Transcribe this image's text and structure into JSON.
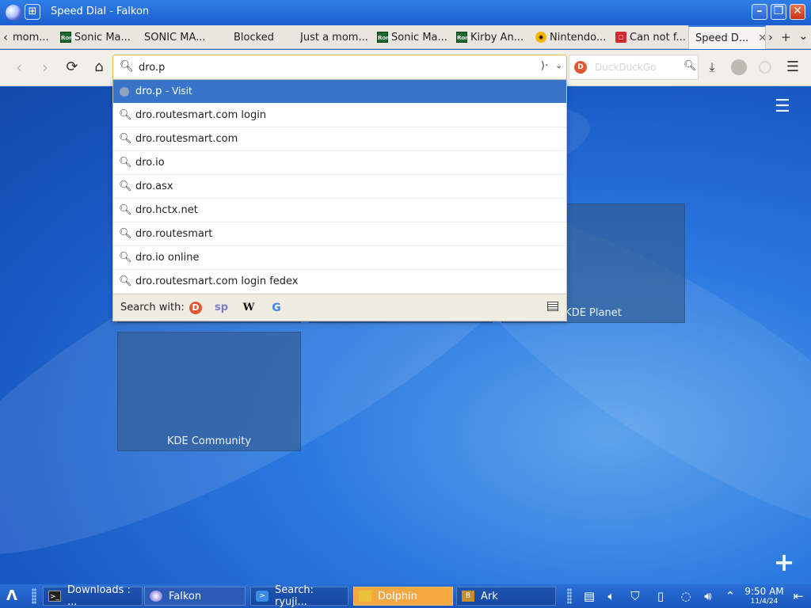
{
  "window": {
    "title": "Speed Dial - Falkon",
    "grid_icon": "grid-icon",
    "buttons": {
      "minimize": "–",
      "maximize": "❐",
      "close": "✕"
    }
  },
  "tabs": [
    {
      "label": "mom...",
      "favicon": ""
    },
    {
      "label": "Sonic Ma...",
      "favicon": "Roms"
    },
    {
      "label": "SONIC MA...",
      "favicon": ""
    },
    {
      "label": "Blocked",
      "favicon": ""
    },
    {
      "label": "Just a mom...",
      "favicon": ""
    },
    {
      "label": "Sonic Ma...",
      "favicon": "Roms"
    },
    {
      "label": "Kirby An...",
      "favicon": "Roms"
    },
    {
      "label": "Nintendo...",
      "favicon": "nintendo-icon"
    },
    {
      "label": "Can not f...",
      "favicon": "cannot-icon"
    },
    {
      "label": "Speed D...",
      "favicon": "",
      "active": true
    }
  ],
  "tab_controls": {
    "scroll_left": "‹",
    "scroll_right": "›",
    "new_tab": "+",
    "tab_list": "⌄"
  },
  "nav": {
    "back": "‹",
    "forward": "›",
    "reload": "⟳",
    "home": "⌂",
    "url_value": "dro.p",
    "search_placeholder": "DuckDuckGo"
  },
  "dropdown": {
    "selected": {
      "text": "dro.p",
      "suffix": "-  Visit"
    },
    "suggestions": [
      "dro.routesmart.com login",
      "dro.routesmart.com",
      "dro.io",
      "dro.asx",
      "dro.hctx.net",
      "dro.routesmart",
      "dro.io online",
      "dro.routesmart.com login fedex"
    ],
    "search_with_label": "Search with:",
    "engines": [
      "duckduckgo-icon",
      "startpage-icon",
      "wikipedia-icon",
      "google-icon"
    ]
  },
  "speed_dial": {
    "tiles": [
      {
        "label": ""
      },
      {
        "label": ""
      },
      {
        "label": "KDE Planet"
      },
      {
        "label": "KDE Community"
      }
    ]
  },
  "taskbar": {
    "tasks": [
      {
        "label": "Downloads : ...",
        "icon": "terminal-icon"
      },
      {
        "label": "Falkon",
        "icon": "falkon-icon"
      },
      {
        "label": "Search: ryuji...",
        "icon": "search-app-icon"
      },
      {
        "label": "Dolphin",
        "icon": "folder-icon"
      },
      {
        "label": "Ark",
        "icon": "archive-icon"
      }
    ],
    "clock": {
      "time": "9:50 AM",
      "date": "11/4/24"
    }
  }
}
